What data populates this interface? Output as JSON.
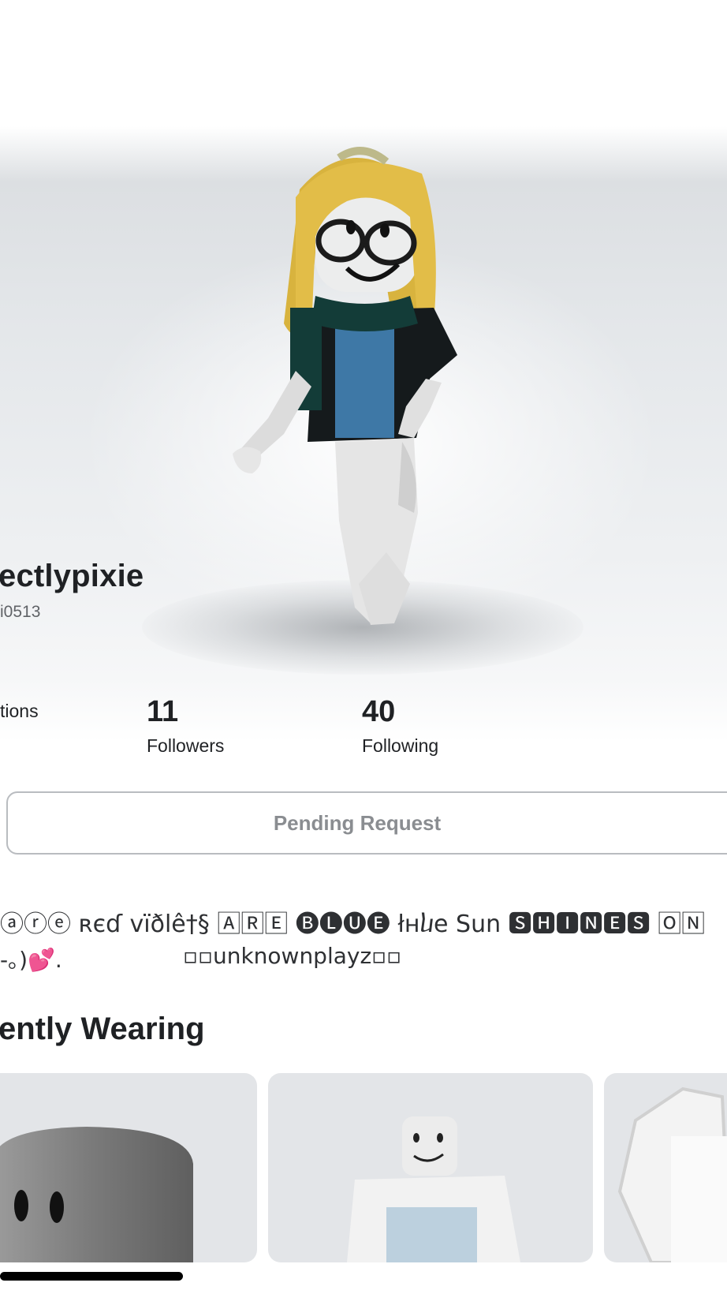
{
  "profile": {
    "display_name": "ectlypixie",
    "username": "i0513"
  },
  "stats": [
    {
      "count": "",
      "label": "tions"
    },
    {
      "count": "11",
      "label": "Followers"
    },
    {
      "count": "40",
      "label": "Following"
    }
  ],
  "actions": {
    "pending_label": "Pending Request"
  },
  "bio": {
    "line1": "ⓐⓡⓔ ʀєɗ vïðlê†§ 🄰🅁🄴 🅑🅛🅤🅔 łнⴑe Sun 🆂🅷🅸🅽🅴🆂 🄾🄽",
    "line2_left": "-｡)💕.",
    "line2_right": "▫▫unknownplayz▫▫"
  },
  "currently_wearing": {
    "title": "ently Wearing"
  },
  "icons": {
    "items": [
      "head-item-icon",
      "avatar-bundle-icon",
      "shirt-item-icon"
    ]
  }
}
